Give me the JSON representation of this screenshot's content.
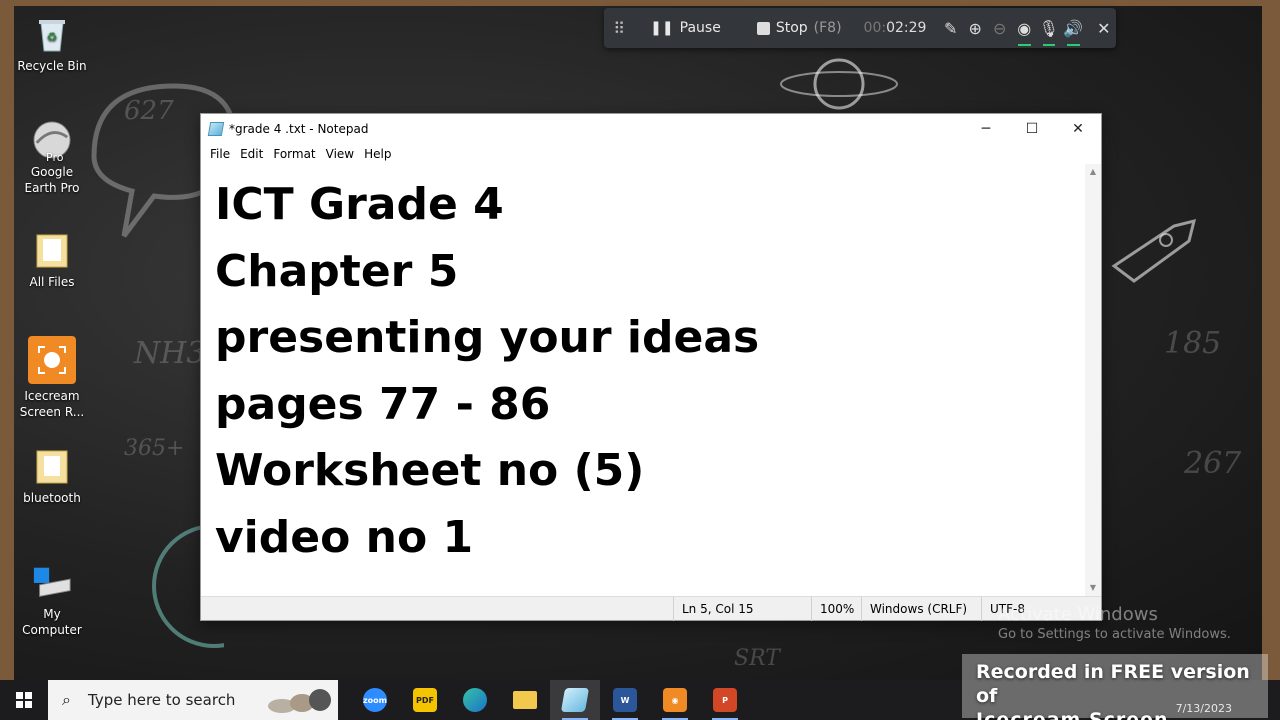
{
  "desktop": {
    "icons": [
      {
        "label": "Recycle Bin"
      },
      {
        "label": "Google Earth Pro",
        "badge": "Pro"
      },
      {
        "label": "All Files"
      },
      {
        "label": "Icecream Screen R..."
      },
      {
        "label": "bluetooth"
      },
      {
        "label": "My Computer"
      }
    ],
    "chalk_text": [
      "627",
      "NH3",
      "365+",
      "185",
      "267",
      "SRT"
    ]
  },
  "recorder": {
    "pause_label": "Pause",
    "stop_label": "Stop",
    "stop_shortcut": "(F8)",
    "time_dim": "00:",
    "time": "02:29"
  },
  "notepad": {
    "title": "*grade 4 .txt - Notepad",
    "menu": [
      "File",
      "Edit",
      "Format",
      "View",
      "Help"
    ],
    "lines": [
      "ICT Grade 4",
      "Chapter 5",
      "presenting your ideas",
      "pages 77 - 86",
      "Worksheet no (5)",
      "video no 1"
    ],
    "status": {
      "position": "Ln 5, Col 15",
      "zoom": "100%",
      "line_ending": "Windows (CRLF)",
      "encoding": "UTF-8"
    }
  },
  "watermarks": {
    "activate_title": "Activate Windows",
    "activate_sub": "Go to Settings to activate Windows.",
    "recorder_line1": "Recorded in FREE version of",
    "recorder_line2": "Icecream Screen Recorder"
  },
  "taskbar": {
    "search_placeholder": "Type here to search",
    "apps": [
      "zoom",
      "pdf",
      "edge",
      "file-explorer",
      "notepad",
      "word",
      "icecream-recorder",
      "powerpoint"
    ],
    "date": "7/13/2023"
  }
}
